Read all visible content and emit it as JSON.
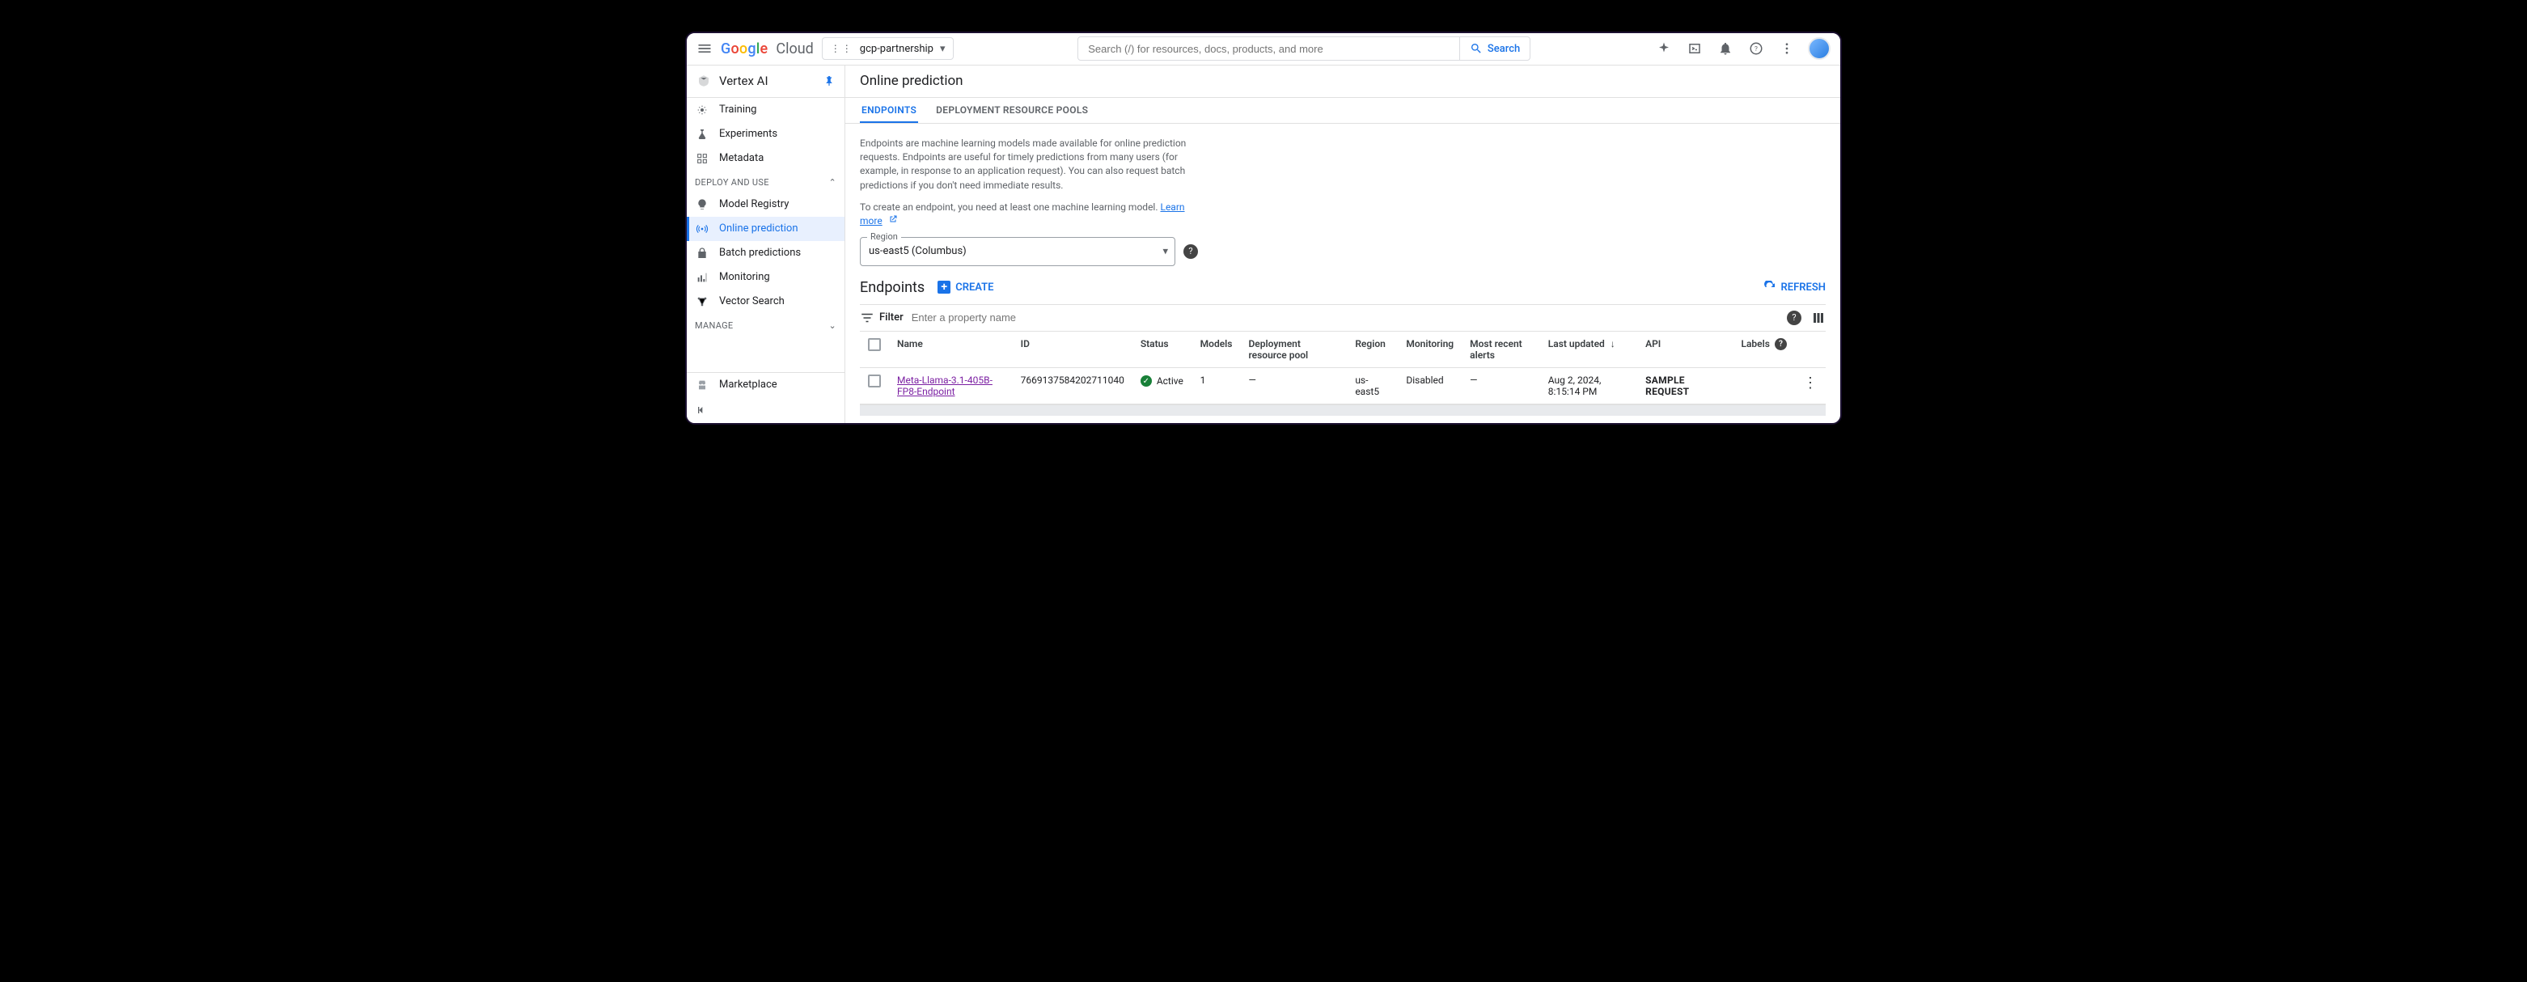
{
  "header": {
    "logo_cloud_word": "Cloud",
    "project_name": "gcp-partnership",
    "search_placeholder": "Search (/) for resources, docs, products, and more",
    "search_button": "Search"
  },
  "sidebar": {
    "product_title": "Vertex AI",
    "sections": {
      "top_items": [
        {
          "icon": "training-icon",
          "label": "Training"
        },
        {
          "icon": "experiments-icon",
          "label": "Experiments"
        },
        {
          "icon": "metadata-icon",
          "label": "Metadata"
        }
      ],
      "deploy_label": "DEPLOY AND USE",
      "deploy_items": [
        {
          "icon": "bulb-icon",
          "label": "Model Registry"
        },
        {
          "icon": "broadcast-icon",
          "label": "Online prediction",
          "active": true
        },
        {
          "icon": "lock-icon",
          "label": "Batch predictions"
        },
        {
          "icon": "chart-icon",
          "label": "Monitoring"
        },
        {
          "icon": "graph-icon",
          "label": "Vector Search"
        }
      ],
      "manage_label": "MANAGE",
      "marketplace_label": "Marketplace"
    }
  },
  "main": {
    "title": "Online prediction",
    "tabs": [
      {
        "id": "endpoints",
        "label": "ENDPOINTS",
        "active": true
      },
      {
        "id": "pools",
        "label": "DEPLOYMENT RESOURCE POOLS"
      }
    ],
    "intro_p1": "Endpoints are machine learning models made available for online prediction requests. Endpoints are useful for timely predictions from many users (for example, in response to an application request). You can also request batch predictions if you don't need immediate results.",
    "intro_p2_pre": "To create an endpoint, you need at least one machine learning model. ",
    "learn_more": "Learn more",
    "region_label": "Region",
    "region_value": "us-east5 (Columbus)",
    "endpoints_title": "Endpoints",
    "create_label": "CREATE",
    "refresh_label": "REFRESH",
    "filter_label": "Filter",
    "filter_placeholder": "Enter a property name",
    "columns": {
      "name": "Name",
      "id": "ID",
      "status": "Status",
      "models": "Models",
      "pool": "Deployment resource pool",
      "region": "Region",
      "monitoring": "Monitoring",
      "alerts": "Most recent alerts",
      "last_updated": "Last updated",
      "api": "API",
      "labels": "Labels"
    },
    "rows": [
      {
        "name": "Meta-Llama-3.1-405B-FP8-Endpoint",
        "id": "7669137584202711040",
        "status": "Active",
        "models": "1",
        "pool": "—",
        "region": "us-east5",
        "monitoring": "Disabled",
        "alerts": "—",
        "last_updated": "Aug 2, 2024, 8:15:14 PM",
        "api": "SAMPLE REQUEST",
        "labels": ""
      }
    ]
  }
}
